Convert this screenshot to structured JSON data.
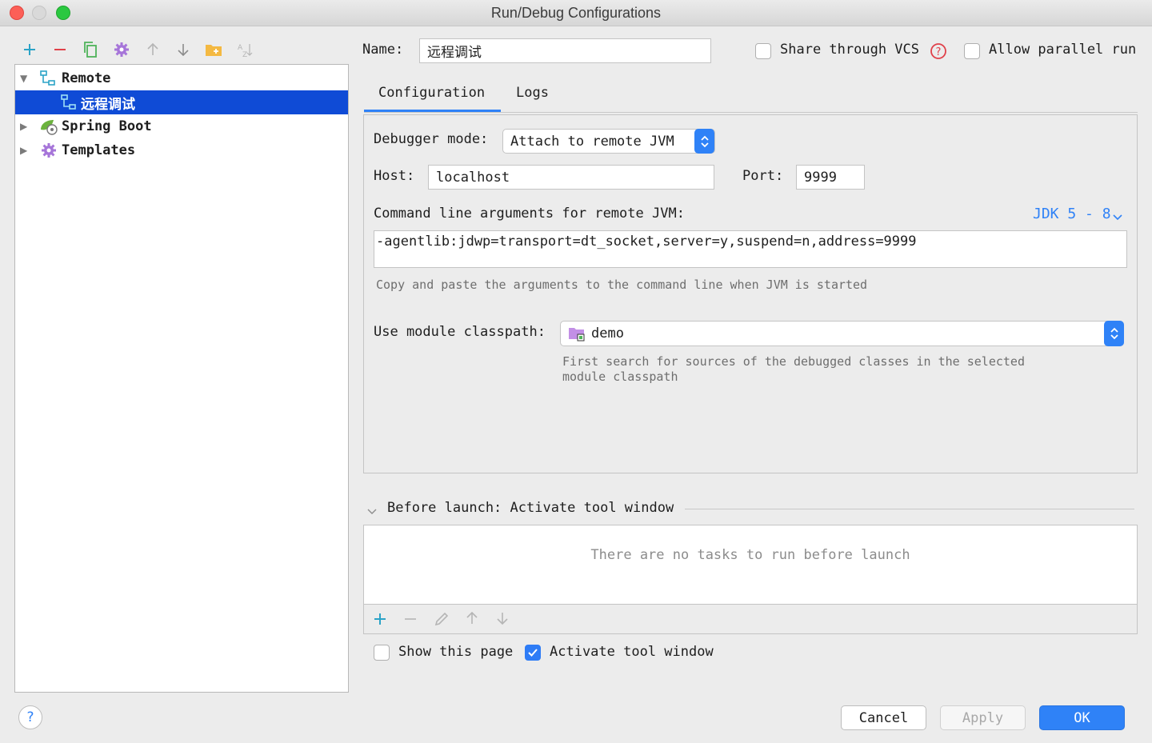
{
  "window": {
    "title": "Run/Debug Configurations"
  },
  "tree": {
    "items": [
      {
        "label": "Remote",
        "expanded": true,
        "icon": "remote-debug-icon"
      },
      {
        "label": "远程调试",
        "selected": true,
        "icon": "remote-debug-icon"
      },
      {
        "label": "Spring Boot",
        "expanded": false,
        "icon": "spring-boot-icon"
      },
      {
        "label": "Templates",
        "expanded": false,
        "icon": "wrench-gear-icon"
      }
    ]
  },
  "form": {
    "name_label": "Name:",
    "name_value": "远程调试",
    "share_vcs_label": "Share through VCS",
    "share_vcs_checked": false,
    "allow_parallel_label": "Allow parallel run",
    "allow_parallel_checked": false
  },
  "tabs": [
    {
      "label": "Configuration",
      "active": true
    },
    {
      "label": "Logs",
      "active": false
    }
  ],
  "config": {
    "debugger_mode_label": "Debugger mode:",
    "debugger_mode_value": "Attach to remote JVM",
    "host_label": "Host:",
    "host_value": "localhost",
    "port_label": "Port:",
    "port_value": "9999",
    "cmd_label": "Command line arguments for remote JVM:",
    "jdk_version": "JDK 5 - 8",
    "cmd_value": "-agentlib:jdwp=transport=dt_socket,server=y,suspend=n,address=9999",
    "cmd_hint": "Copy and paste the arguments to the command line when JVM is started",
    "module_label": "Use module classpath:",
    "module_value": "demo",
    "module_hint_line1": "First search for sources of the debugged classes in the selected",
    "module_hint_line2": "module classpath"
  },
  "before_launch": {
    "title": "Before launch: Activate tool window",
    "empty_text": "There are no tasks to run before launch"
  },
  "options": {
    "show_page_label": "Show this page",
    "show_page_checked": false,
    "activate_tool_label": "Activate tool window",
    "activate_tool_checked": true
  },
  "buttons": {
    "cancel": "Cancel",
    "apply": "Apply",
    "ok": "OK",
    "help": "?"
  },
  "colors": {
    "accent": "#2f82f7",
    "selection": "#0f4bd6",
    "add_icon": "#2ba3c7",
    "remove_icon": "#e0414a",
    "help_red": "#e0414a"
  }
}
